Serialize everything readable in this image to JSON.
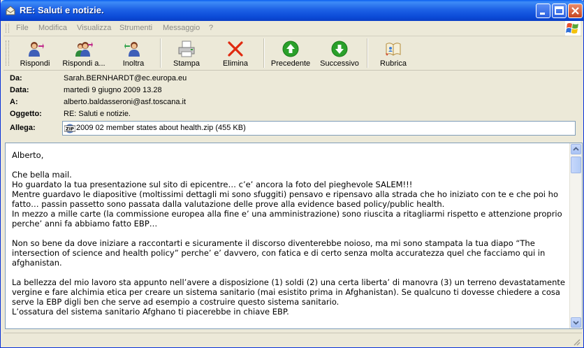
{
  "window": {
    "title": "RE: Saluti e notizie."
  },
  "menu": [
    "File",
    "Modifica",
    "Visualizza",
    "Strumenti",
    "Messaggio",
    "?"
  ],
  "toolbar": {
    "reply": "Rispondi",
    "reply_all": "Rispondi a...",
    "forward": "Inoltra",
    "print": "Stampa",
    "delete": "Elimina",
    "previous": "Precedente",
    "next": "Successivo",
    "address_book": "Rubrica"
  },
  "headers": {
    "from_label": "Da:",
    "from_value": "Sarah.BERNHARDT@ec.europa.eu",
    "date_label": "Data:",
    "date_value": "martedì 9 giugno 2009 13.28",
    "to_label": "A:",
    "to_value": "alberto.baldasseroni@asf.toscana.it",
    "subject_label": "Oggetto:",
    "subject_value": "RE: Saluti e notizie.",
    "attach_label": "Allega:",
    "attach_value": "2009 02 member states about health.zip (455 KB)"
  },
  "body": {
    "greeting": "Alberto,",
    "p1": "Che bella mail.\nHo guardato la tua presentazione sul sito di epicentre… c’e’ ancora la foto del pieghevole SALEM!!!\nMentre guardavo le diapositive (moltissimi dettagli mi sono sfuggiti) pensavo e ripensavo alla strada che ho iniziato con te e che poi ho fatto… passin passetto sono passata dalla valutazione delle prove alla evidence based policy/public health.\nIn mezzo a mille carte (la commissione europea alla fine e’ una amministrazione) sono riuscita a ritagliarmi rispetto e attenzione proprio perche’ anni fa abbiamo fatto EBP…",
    "p2": "Non so bene da dove iniziare a raccontarti e sicuramente il discorso diventerebbe noioso, ma mi sono stampata la tua diapo “The intersection of science and health policy” perche’ e’ davvero, con fatica e di certo senza molta accuratezza quel che facciamo qui in afghanistan.",
    "p3": "La bellezza del mio lavoro sta appunto nell’avere a disposizione (1) soldi (2) una certa liberta’ di manovra (3) un terreno devastatamente vergine e fare alchimia etica per creare un sistema sanitario (mai esistito prima in Afghanistan). Se qualcuno ti dovesse chiedere a cosa serve la EBP digli ben che serve ad esempio a costruire questo sistema sanitario.\nL’ossatura del sistema sanitario Afghano ti piacerebbe in chiave EBP."
  },
  "colors": {
    "titlebar": "#0a4bd8",
    "chrome": "#ece9d8",
    "menu_disabled": "#8c8b86"
  }
}
